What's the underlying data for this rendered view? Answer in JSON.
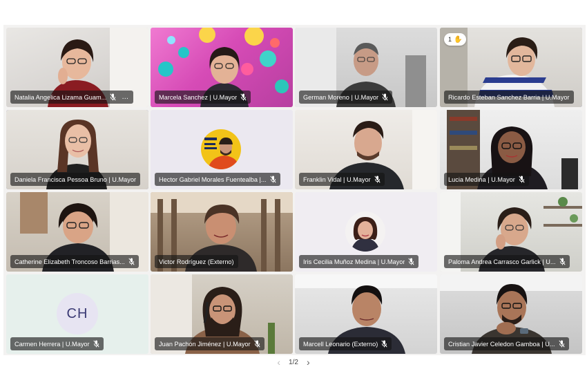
{
  "gallery": {
    "participants": [
      {
        "name": "Natalia Angelica Lizama Guam...",
        "avatar": "video",
        "more": "…"
      },
      {
        "name": "Marcela Sanchez | U.Mayor",
        "avatar": "video"
      },
      {
        "name": "German Moreno | U.Mayor",
        "avatar": "video"
      },
      {
        "name": "Ricardo Esteban Sanchez Barria | U.Mayor",
        "avatar": "video",
        "reaction_count": "1",
        "reaction_icon": "raised-hand-icon"
      },
      {
        "name": "Daniela Francisca Pessoa Bruno | U.Mayor",
        "avatar": "video"
      },
      {
        "name": "Hector Gabriel Morales Fuentealba |...",
        "avatar": "photo"
      },
      {
        "name": "Franklin Vidal | U.Mayor",
        "avatar": "video"
      },
      {
        "name": "Lucia Medina | U.Mayor",
        "avatar": "video"
      },
      {
        "name": "Catherine Elizabeth Troncoso Barrias...",
        "avatar": "video"
      },
      {
        "name": "Victor Rodríguez (Externo)",
        "avatar": "video"
      },
      {
        "name": "Iris Cecilia Muñoz Medina | U.Mayor",
        "avatar": "photo"
      },
      {
        "name": "Paloma Andrea Carrasco Garlick | U...",
        "avatar": "video"
      },
      {
        "name": "Carmen Herrera | U.Mayor",
        "avatar": "initials",
        "initials": "CH"
      },
      {
        "name": "Juan Pachón Jiménez | U.Mayor",
        "avatar": "video"
      },
      {
        "name": "Marcell Leonario (Externo)",
        "avatar": "video"
      },
      {
        "name": "Cristian Javier Celedon Gamboa | U...",
        "avatar": "video"
      }
    ]
  },
  "pager": {
    "label": "1/2",
    "prev_icon": "chevron-left-icon",
    "next_icon": "chevron-right-icon"
  },
  "colors": {
    "speaking_outline": "#6264a7",
    "nameplate_bg": "rgba(20,20,20,0.62)",
    "initials_bg": "#e7e4f2"
  }
}
